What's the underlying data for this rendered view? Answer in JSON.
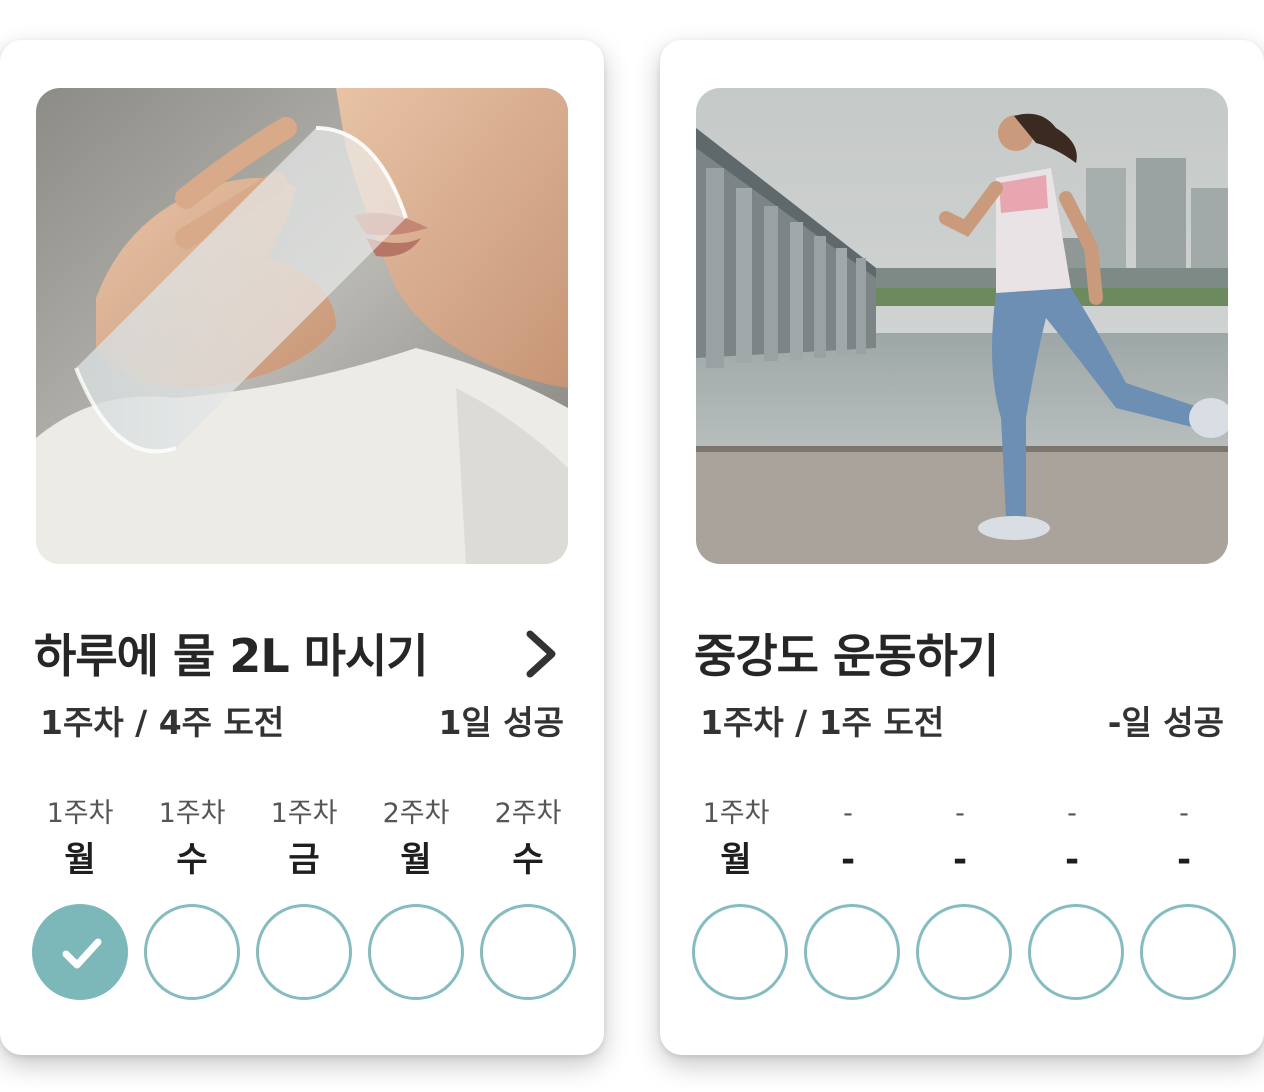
{
  "cards": [
    {
      "title": "하루에 물 2L 마시기",
      "progress": "1주차 / 4주 도전",
      "success": "1일 성공",
      "photo_subject": "woman-drinking-water-photo",
      "days": [
        {
          "week": "1주차",
          "day": "월",
          "done": true
        },
        {
          "week": "1주차",
          "day": "수",
          "done": false
        },
        {
          "week": "1주차",
          "day": "금",
          "done": false
        },
        {
          "week": "2주차",
          "day": "월",
          "done": false
        },
        {
          "week": "2주차",
          "day": "수",
          "done": false
        }
      ]
    },
    {
      "title": "중강도 운동하기",
      "progress": "1주차 / 1주 도전",
      "success": "-일 성공",
      "photo_subject": "woman-running-by-river-photo",
      "days": [
        {
          "week": "1주차",
          "day": "월",
          "done": false
        },
        {
          "week": "-",
          "day": "-",
          "done": false
        },
        {
          "week": "-",
          "day": "-",
          "done": false
        },
        {
          "week": "-",
          "day": "-",
          "done": false
        },
        {
          "week": "-",
          "day": "-",
          "done": false
        }
      ]
    }
  ],
  "colors": {
    "accent": "#7cb7ba",
    "circle_border": "#84bcc0",
    "title_text": "#262626"
  },
  "icons": {
    "detail": "chevron-right-icon",
    "completed": "checkmark-icon"
  }
}
